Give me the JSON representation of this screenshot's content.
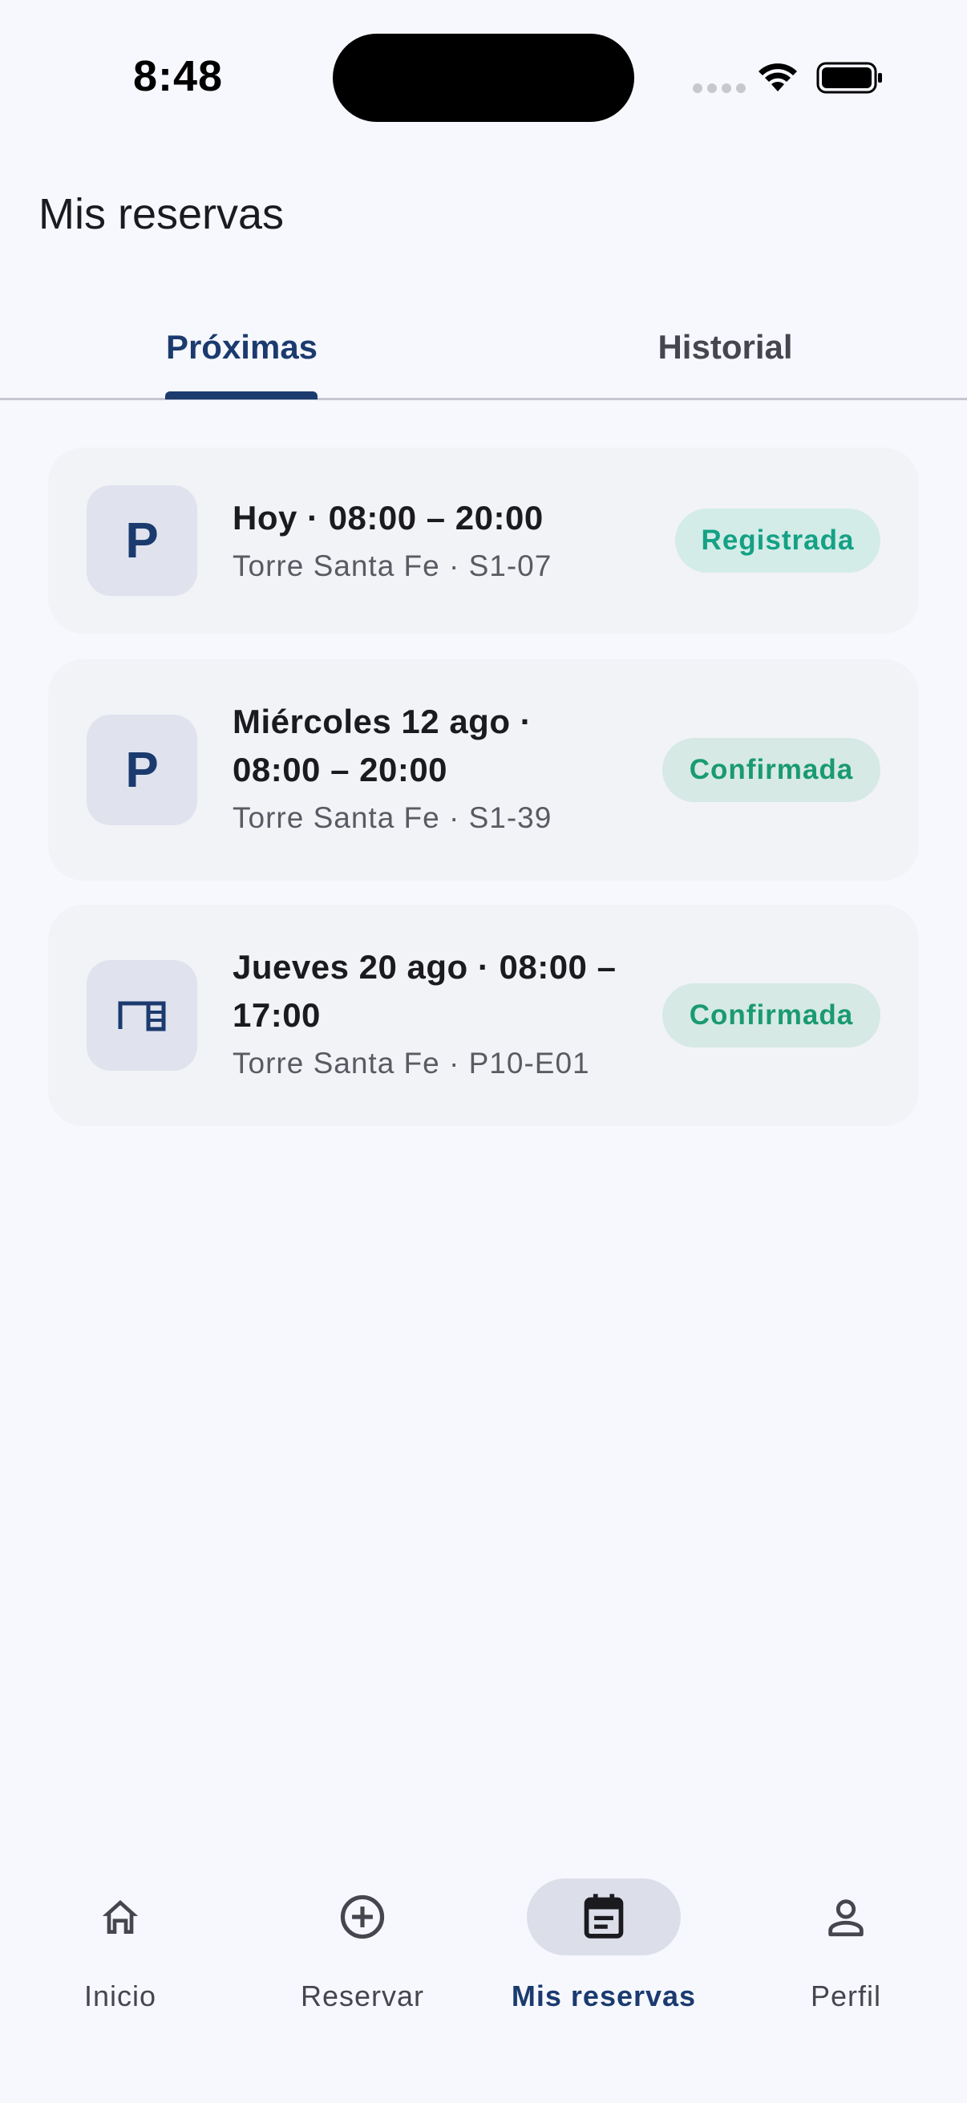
{
  "status_bar": {
    "time": "8:48"
  },
  "page": {
    "title": "Mis reservas"
  },
  "tabs": [
    {
      "label": "Próximas",
      "selected": true
    },
    {
      "label": "Historial",
      "selected": false
    }
  ],
  "reservations": [
    {
      "icon": "parking-icon",
      "icon_text": "P",
      "title": "Hoy · 08:00 – 20:00",
      "subtitle": "Torre Santa Fe · S1-07",
      "status": "Registrada"
    },
    {
      "icon": "parking-icon",
      "icon_text": "P",
      "title": "Miércoles 12 ago · 08:00 – 20:00",
      "subtitle": "Torre Santa Fe · S1-39",
      "status": "Confirmada"
    },
    {
      "icon": "desk-icon",
      "title": "Jueves 20 ago · 08:00 – 17:00",
      "subtitle": "Torre Santa Fe · P10-E01",
      "status": "Confirmada"
    }
  ],
  "bottom_nav": [
    {
      "label": "Inicio",
      "icon": "home-icon",
      "active": false
    },
    {
      "label": "Reservar",
      "icon": "add-circle-icon",
      "active": false
    },
    {
      "label": "Mis reservas",
      "icon": "calendar-icon",
      "active": true
    },
    {
      "label": "Perfil",
      "icon": "person-icon",
      "active": false
    }
  ],
  "colors": {
    "background": "#F7F8FE",
    "primary": "#1B3B6F",
    "card": "#F2F3F7",
    "registered_text": "#14A185",
    "registered_bg": "#D3ECE8",
    "confirmed_text": "#1A9A71",
    "confirmed_bg": "#D6E9E5"
  }
}
